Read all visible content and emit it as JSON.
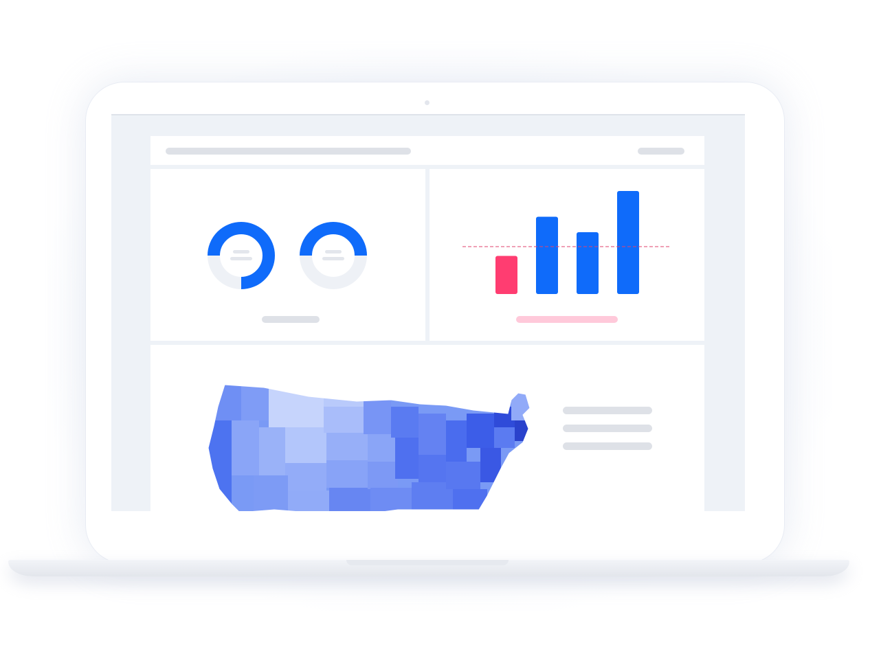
{
  "colors": {
    "accent": "#0f6bfa",
    "accent_dark": "#2f50e0",
    "highlight": "#ff3d71",
    "highlight_soft": "#ffc9da",
    "screen_bg": "#eef2f7",
    "panel_bg": "#ffffff",
    "placeholder": "#dee1e7",
    "donut_track": "#eef1f6"
  },
  "icons": {
    "camera": "webcam-dot"
  },
  "donuts": [
    {
      "fill_fraction": 0.75
    },
    {
      "fill_fraction": 0.5
    }
  ],
  "chart_data": {
    "type": "bar",
    "title": "",
    "xlabel": "",
    "ylabel": "",
    "categories": [
      "",
      "",
      "",
      ""
    ],
    "values": [
      37,
      75,
      60,
      100
    ],
    "bar_colors": [
      "#ff3d71",
      "#0f6bfa",
      "#0f6bfa",
      "#0f6bfa"
    ],
    "reference_line": 46,
    "reference_line_color": "#e0406d",
    "reference_line_style": "dashed",
    "ylim": [
      0,
      100
    ],
    "grid": false
  },
  "map": {
    "type": "choropleth",
    "region": "United States"
  }
}
